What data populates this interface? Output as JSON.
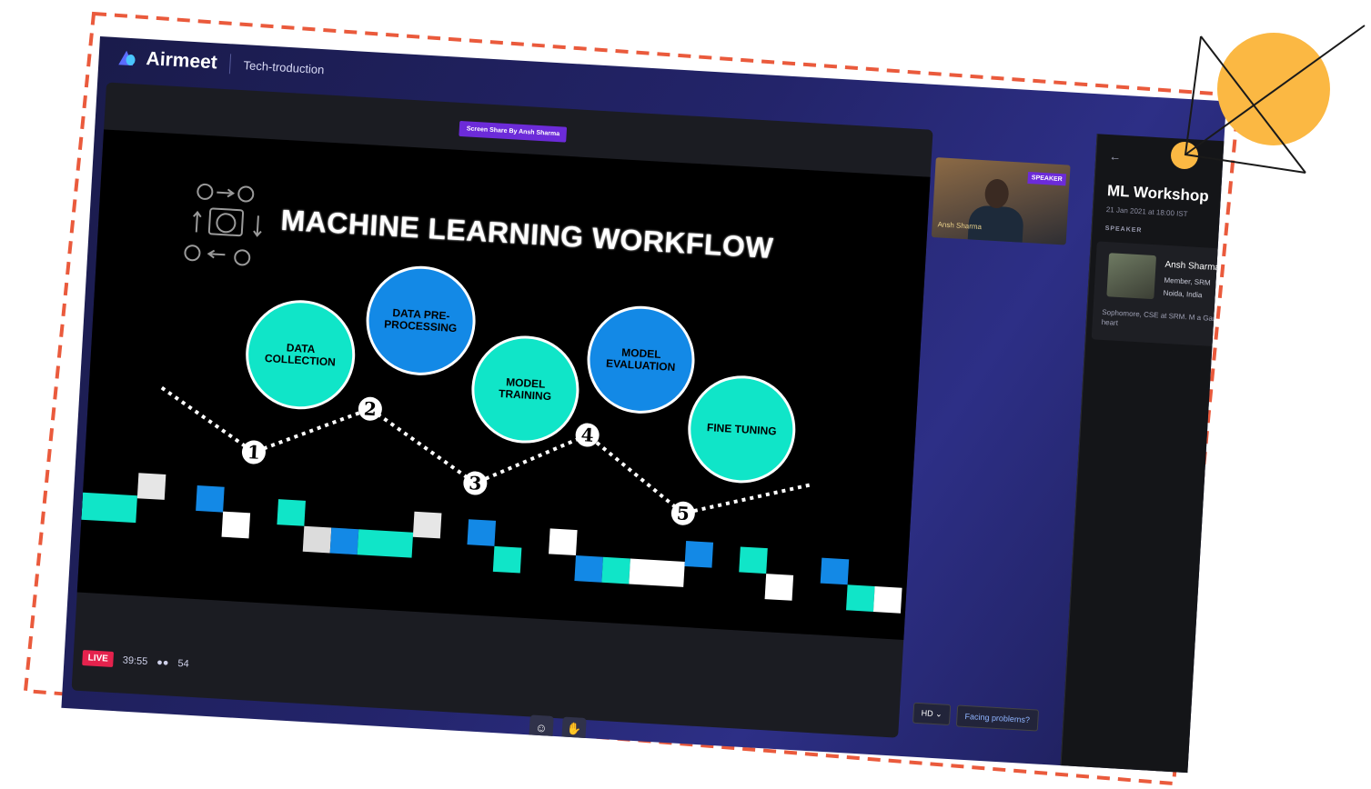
{
  "app": {
    "brand": "Airmeet",
    "event_name": "Tech-troduction"
  },
  "stage": {
    "screen_share_badge": "Screen Share By Ansh Sharma",
    "slide": {
      "title": "MACHINE LEARNING WORKFLOW",
      "steps": [
        {
          "number": "1",
          "label": "DATA COLLECTION",
          "color": "#10e5c8"
        },
        {
          "number": "2",
          "label": "DATA PRE-PROCESSING",
          "color": "#1389e6"
        },
        {
          "number": "3",
          "label": "MODEL TRAINING",
          "color": "#10e5c8"
        },
        {
          "number": "4",
          "label": "MODEL EVALUATION",
          "color": "#1389e6"
        },
        {
          "number": "5",
          "label": "FINE TUNING",
          "color": "#10e5c8"
        }
      ]
    }
  },
  "speaker_tile": {
    "tag": "SPEAKER",
    "name": "Ansh Sharma"
  },
  "status": {
    "live_label": "LIVE",
    "timer": "39:55",
    "attendees": "54"
  },
  "controls": {
    "emoji_icon": "smiley-icon",
    "raise_hand_icon": "hand-icon",
    "hd_label": "HD",
    "facing_problems": "Facing problems?"
  },
  "side_panel": {
    "title": "ML Workshop",
    "date": "21 Jan 2021 at 18:00 IST",
    "speaker_label": "SPEAKER",
    "speaker_name": "Ansh Sharma",
    "speaker_role": "Member, SRM",
    "speaker_location": "Noida, India",
    "speaker_bio": "Sophomore, CSE at SRM. M a Gamer by heart"
  },
  "colors": {
    "frame_dash": "#ea5a3c",
    "annotation_circle": "#fbb843",
    "teal": "#10e5c8",
    "blue": "#1389e6",
    "live": "#e5224d",
    "purple_badge": "#6c2bd9"
  }
}
